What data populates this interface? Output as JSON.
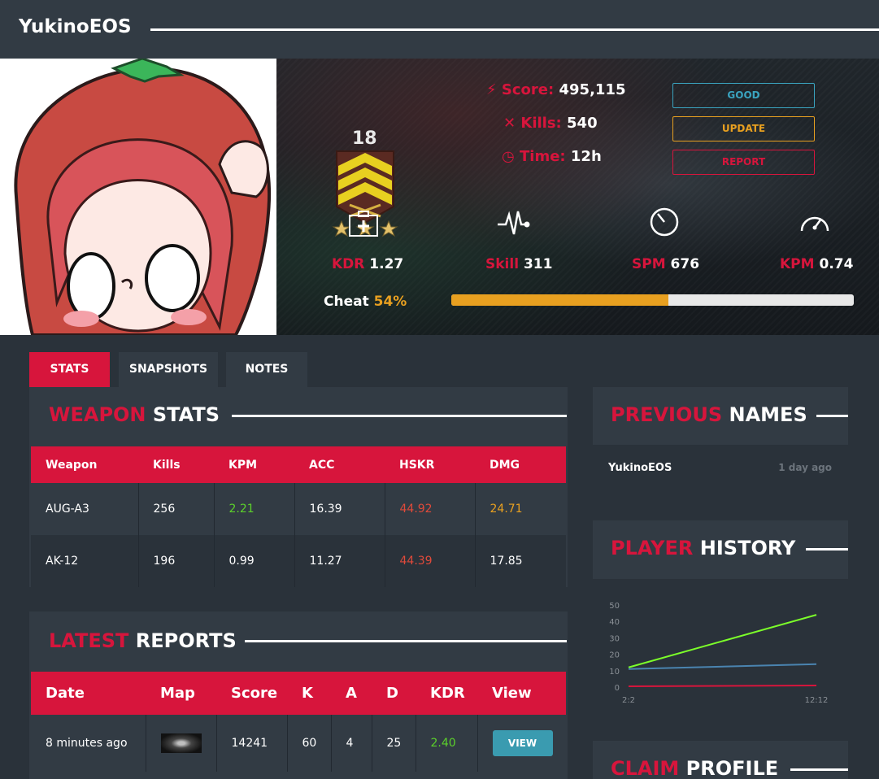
{
  "header": {
    "player_name": "YukinoEOS"
  },
  "rank": {
    "level": "18",
    "stars": 3
  },
  "summary": {
    "score_label": "Score:",
    "score_value": "495,115",
    "kills_label": "Kills:",
    "kills_value": "540",
    "time_label": "Time:",
    "time_value": "12h"
  },
  "actions": {
    "good": "GOOD",
    "update": "UPDATE",
    "report": "REPORT"
  },
  "stats": {
    "kdr_label": "KDR",
    "kdr_value": "1.27",
    "skill_label": "Skill",
    "skill_value": "311",
    "spm_label": "SPM",
    "spm_value": "676",
    "kpm_label": "KPM",
    "kpm_value": "0.74"
  },
  "cheat": {
    "label": "Cheat",
    "value": "54%",
    "fraction": 0.54
  },
  "tabs": [
    {
      "label": "STATS"
    },
    {
      "label": "SNAPSHOTS"
    },
    {
      "label": "NOTES"
    }
  ],
  "weapon_stats": {
    "title_red": "WEAPON",
    "title_white": "STATS",
    "columns": [
      "Weapon",
      "Kills",
      "KPM",
      "ACC",
      "HSKR",
      "DMG"
    ],
    "rows": [
      [
        "AUG-A3",
        "256",
        "2.21",
        "16.39",
        "44.92",
        "24.71"
      ],
      [
        "AK-12",
        "196",
        "0.99",
        "11.27",
        "44.39",
        "17.85"
      ]
    ]
  },
  "latest_reports": {
    "title_red": "LATEST",
    "title_white": "REPORTS",
    "columns": [
      "Date",
      "Map",
      "Score",
      "K",
      "A",
      "D",
      "KDR",
      "View"
    ],
    "rows": [
      {
        "date": "8 minutes ago",
        "score": "14241",
        "k": "60",
        "a": "4",
        "d": "25",
        "kdr": "2.40",
        "view": "VIEW"
      }
    ]
  },
  "previous_names": {
    "title_red": "PREVIOUS",
    "title_white": "NAMES",
    "items": [
      {
        "name": "YukinoEOS",
        "time": "1 day ago"
      }
    ]
  },
  "player_history": {
    "title_red": "PLAYER",
    "title_white": "HISTORY"
  },
  "claim_profile": {
    "title_red": "CLAIM",
    "title_white": "PROFILE"
  },
  "colors": {
    "accent": "#d7153c",
    "warning": "#e8a020",
    "info": "#3aa4c0",
    "good": "#5cd12b",
    "panel": "#323b44",
    "background": "#2a323a"
  },
  "chart_data": {
    "type": "line",
    "x": [
      "2:2",
      "12:12"
    ],
    "yticks": [
      0,
      10,
      20,
      30,
      40,
      50
    ],
    "ylim": [
      0,
      50
    ],
    "series": [
      {
        "color": "#7cff2a",
        "values": [
          12,
          44
        ]
      },
      {
        "color": "#4a84b0",
        "values": [
          11,
          14
        ]
      },
      {
        "color": "#d7153c",
        "values": [
          0.5,
          1
        ]
      }
    ]
  }
}
